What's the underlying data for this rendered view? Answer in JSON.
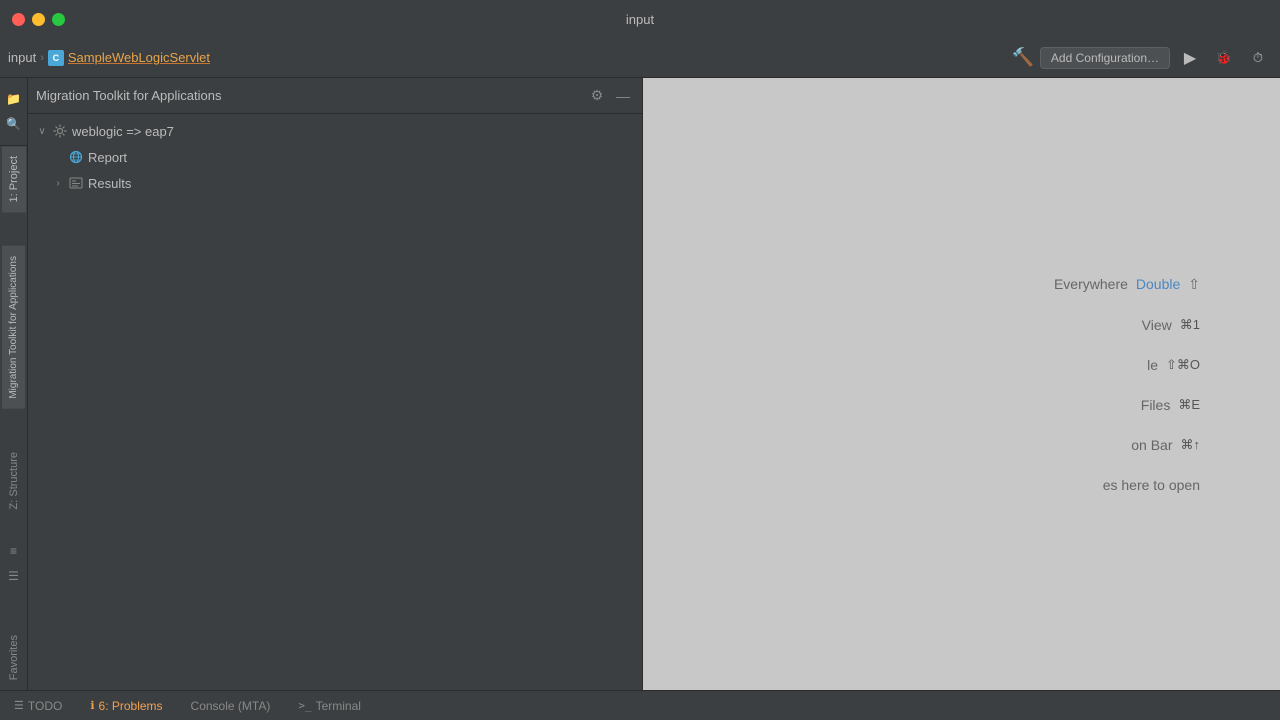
{
  "window": {
    "title": "input"
  },
  "traffic_lights": {
    "close_label": "",
    "minimize_label": "",
    "maximize_label": ""
  },
  "nav": {
    "breadcrumb_input": "input",
    "breadcrumb_chevron": "›",
    "breadcrumb_class_icon": "C",
    "breadcrumb_file": "SampleWebLogicServlet",
    "add_config_label": "Add Configuration…",
    "hammer_icon": "🔨",
    "run_icon": "▶",
    "debug_icon": "🐞",
    "profile_icon": "⏱"
  },
  "tool_panel": {
    "title": "Migration Toolkit for Applications",
    "gear_icon": "⚙",
    "minimize_icon": "—"
  },
  "tree": {
    "root": {
      "label": "weblogic => eap7",
      "chevron": "∨",
      "children": [
        {
          "label": "Report",
          "icon": "globe"
        },
        {
          "label": "Results",
          "chevron": "›",
          "icon": "results"
        }
      ]
    }
  },
  "right_panel": {
    "lines": [
      {
        "prefix": "Everywhere ",
        "link": "Double",
        "suffix": " ⇧"
      },
      {
        "prefix": "View ",
        "link": "",
        "suffix": "⌘1"
      },
      {
        "prefix": "le ",
        "link": "",
        "suffix": "⇧⌘O"
      },
      {
        "prefix": "Files ",
        "link": "",
        "suffix": "⌘E"
      },
      {
        "prefix": "on Bar ",
        "link": "",
        "suffix": "⌘↑"
      },
      {
        "prefix": "es here to open",
        "link": "",
        "suffix": ""
      }
    ]
  },
  "left_vertical_tabs": {
    "project_label": "1: Project",
    "migration_label": "Migration Toolkit for Applications",
    "structure_label": "Z: Structure",
    "favorites_label": "Favorites"
  },
  "bottom_bar": {
    "todo_label": "TODO",
    "todo_icon": "☰",
    "problems_icon": "ℹ",
    "problems_label": "6: Problems",
    "console_label": "Console (MTA)",
    "terminal_icon": ">_",
    "terminal_label": "Terminal"
  }
}
